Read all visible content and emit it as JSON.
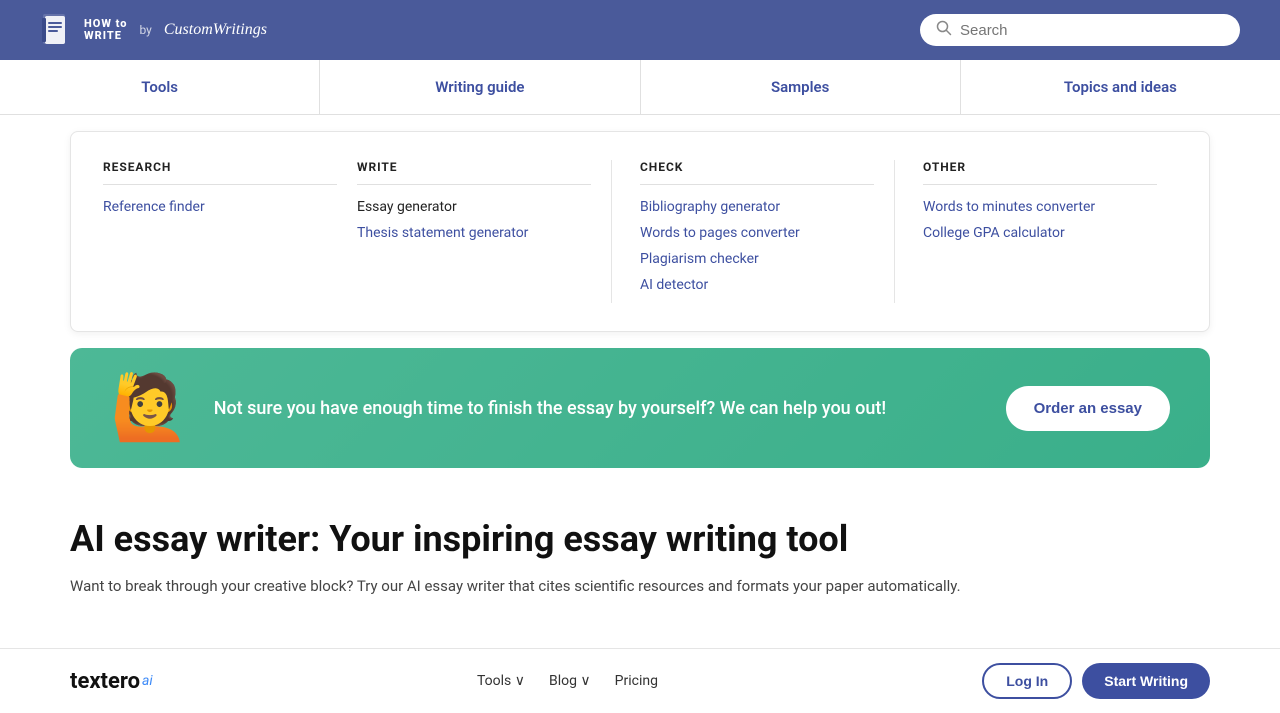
{
  "header": {
    "logo_how": "HOW to\nWRITE",
    "logo_by": "by",
    "logo_brand": "CustomWritings",
    "search_placeholder": "Search"
  },
  "nav": {
    "items": [
      {
        "label": "Tools"
      },
      {
        "label": "Writing guide"
      },
      {
        "label": "Samples"
      },
      {
        "label": "Topics and ideas"
      }
    ]
  },
  "dropdown": {
    "research": {
      "header": "RESEARCH",
      "items": [
        {
          "label": "Reference finder",
          "link": true
        }
      ]
    },
    "write": {
      "header": "WRITE",
      "items": [
        {
          "label": "Essay generator",
          "link": false
        },
        {
          "label": "Thesis statement generator",
          "link": true
        }
      ]
    },
    "check": {
      "header": "CHECK",
      "items": [
        {
          "label": "Bibliography generator",
          "link": true
        },
        {
          "label": "Words to pages converter",
          "link": true
        },
        {
          "label": "Plagiarism checker",
          "link": true
        },
        {
          "label": "AI detector",
          "link": true
        }
      ]
    },
    "other": {
      "header": "OTHER",
      "items": [
        {
          "label": "Words to minutes converter",
          "link": true
        },
        {
          "label": "College GPA calculator",
          "link": true
        }
      ]
    }
  },
  "banner": {
    "emoji": "🙋",
    "text": "Not sure you have enough time to finish the essay by yourself? We can help you out!",
    "button_label": "Order an essay"
  },
  "main": {
    "title": "AI essay writer: Your inspiring essay writing tool",
    "subtitle": "Want to break through your creative block? Try our AI essay writer that cites scientific resources and formats your paper automatically."
  },
  "bottom": {
    "logo": "textero",
    "logo_suffix": "ai",
    "nav_items": [
      {
        "label": "Tools ∨"
      },
      {
        "label": "Blog ∨"
      },
      {
        "label": "Pricing"
      }
    ],
    "login_label": "Log In",
    "start_label": "Start Writing"
  }
}
